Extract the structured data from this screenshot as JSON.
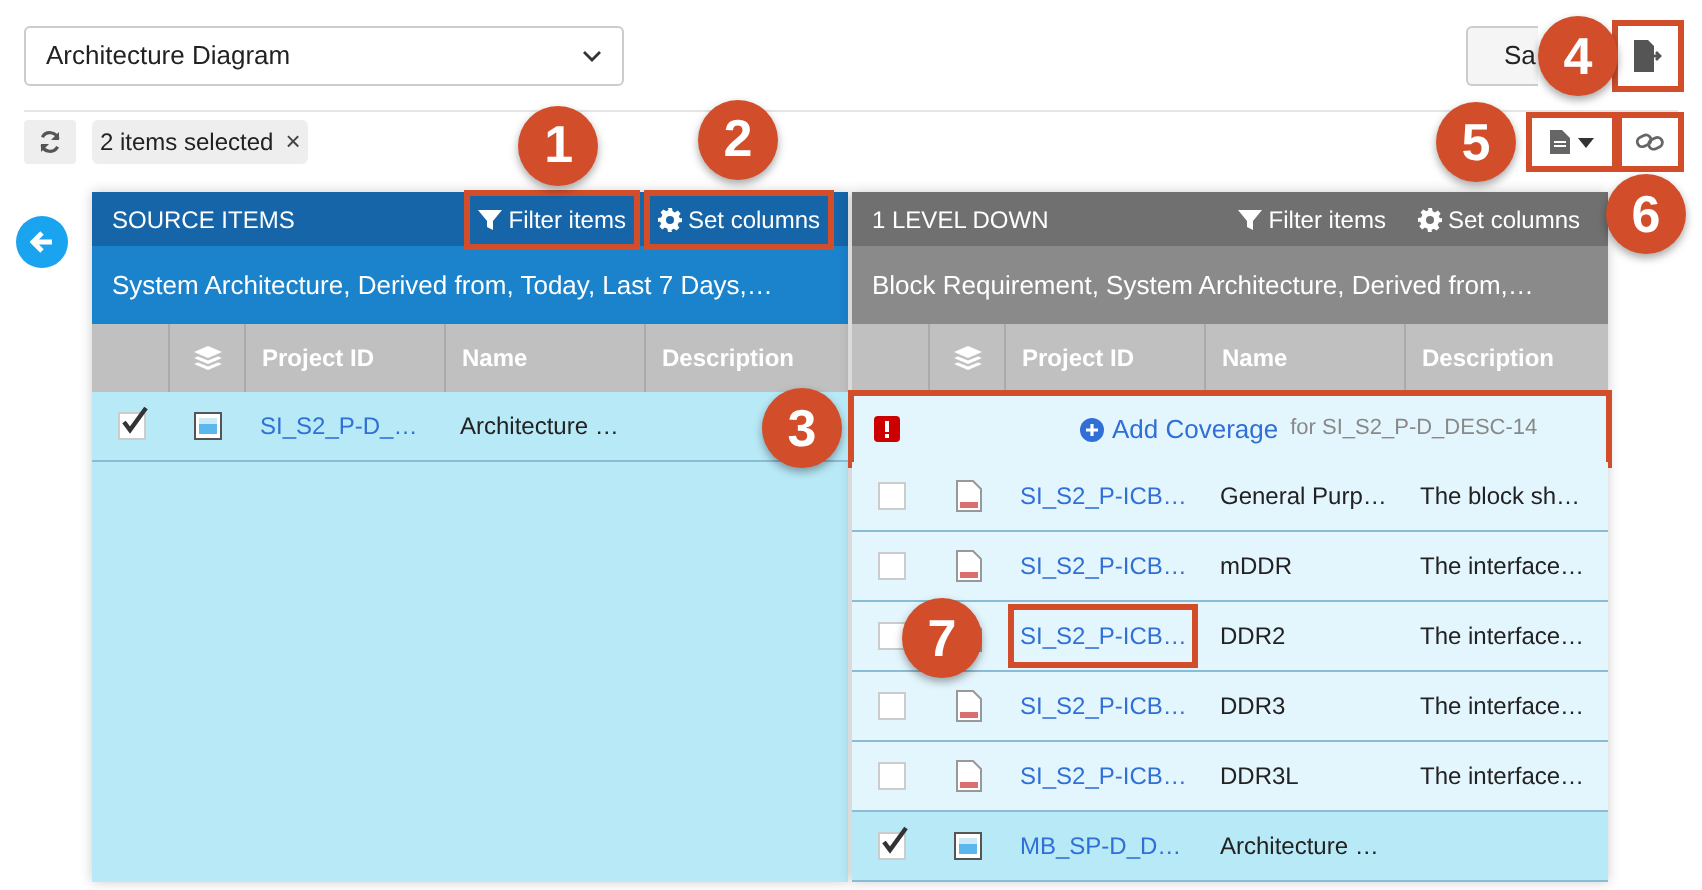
{
  "selector": {
    "value": "Architecture Diagram"
  },
  "save_button": {
    "label": "Sa"
  },
  "export_button": {
    "callout": "4"
  },
  "selection_chip": {
    "label": "2 items selected",
    "close": "×"
  },
  "file_menu_button": {
    "callout": "5"
  },
  "link_button": {
    "callout": "6"
  },
  "source_panel": {
    "title": "SOURCE ITEMS",
    "filter": {
      "label": "Filter items",
      "callout": "1"
    },
    "columns_button": {
      "label": "Set columns",
      "callout": "2"
    },
    "subtitle": "System Architecture, Derived from, Today, Last 7 Days,…",
    "columns": [
      "Project ID",
      "Name",
      "Description"
    ],
    "rows": [
      {
        "kind": "diagram",
        "checked": true,
        "selected": true,
        "project_id": "SI_S2_P-D_…",
        "name": "Architecture …"
      }
    ]
  },
  "target_panel": {
    "title": "1 LEVEL DOWN",
    "filter": {
      "label": "Filter items"
    },
    "columns_button": {
      "label": "Set columns"
    },
    "subtitle": "Block Requirement, System Architecture, Derived from,…",
    "columns": [
      "Project ID",
      "Name",
      "Description"
    ],
    "rows": [
      {
        "kind": "coverage",
        "action": "Add Coverage",
        "detail": "for SI_S2_P-D_DESC-14",
        "callout": "3"
      },
      {
        "kind": "requirement",
        "checked": false,
        "selected": false,
        "project_id": "SI_S2_P-ICB…",
        "name": "General Purp…",
        "description": "The block sh…"
      },
      {
        "kind": "requirement",
        "checked": false,
        "selected": false,
        "project_id": "SI_S2_P-ICB…",
        "name": "mDDR",
        "description": "The interface…"
      },
      {
        "kind": "requirement",
        "checked": false,
        "selected": false,
        "project_id": "SI_S2_P-ICB…",
        "name": "DDR2",
        "description": "The interface…",
        "callout": "7"
      },
      {
        "kind": "requirement",
        "checked": false,
        "selected": false,
        "project_id": "SI_S2_P-ICB…",
        "name": "DDR3",
        "description": "The interface…"
      },
      {
        "kind": "requirement",
        "checked": false,
        "selected": false,
        "project_id": "SI_S2_P-ICB…",
        "name": "DDR3L",
        "description": "The interface…"
      },
      {
        "kind": "diagram",
        "checked": true,
        "selected": true,
        "project_id": "MB_SP-D_D…",
        "name": "Architecture …"
      }
    ]
  }
}
